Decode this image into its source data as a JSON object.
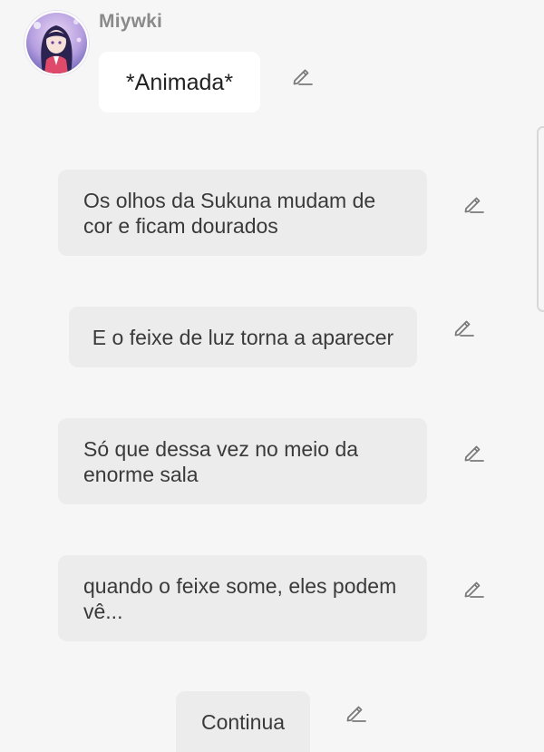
{
  "message": {
    "author": "Miywki",
    "action": "*Animada*"
  },
  "replies": [
    {
      "text": "Os olhos da Sukuna mudam de cor e ficam dourados"
    },
    {
      "text": "E o feixe de luz torna a aparecer"
    },
    {
      "text": "Só que dessa vez no meio da enorme sala"
    },
    {
      "text": "quando o feixe some, eles podem vê..."
    }
  ],
  "continue_label": "Continua",
  "icons": {
    "edit": "pencil-icon",
    "avatar": "anime-avatar"
  },
  "colors": {
    "background": "#f6f6f6",
    "bubble_grey": "#ececec",
    "bubble_white": "#ffffff",
    "author": "#8a8a8a"
  }
}
